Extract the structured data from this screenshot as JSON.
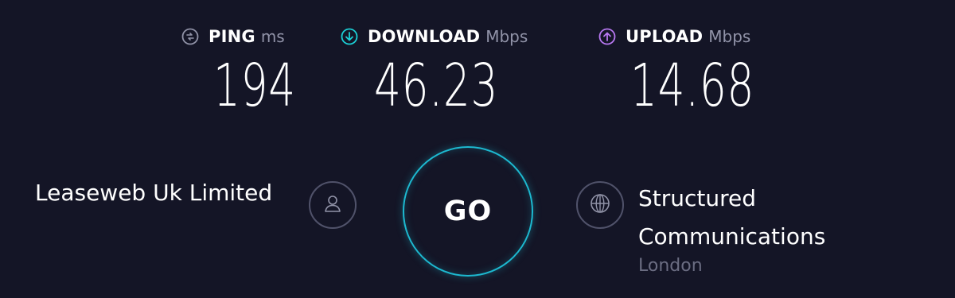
{
  "metrics": {
    "ping": {
      "label": "PING",
      "unit": "ms",
      "value": "194",
      "icon": "ping-icon",
      "color": "#9193a8"
    },
    "download": {
      "label": "DOWNLOAD",
      "unit": "Mbps",
      "value": "46.23",
      "icon": "download-arrow-icon",
      "color": "#1bd0d6"
    },
    "upload": {
      "label": "UPLOAD",
      "unit": "Mbps",
      "value": "14.68",
      "icon": "upload-arrow-icon",
      "color": "#b878f2"
    }
  },
  "provider": {
    "name": "Leaseweb Uk Limited",
    "icon": "user-icon"
  },
  "go_button": {
    "label": "GO",
    "accent": "#1db9d0"
  },
  "server": {
    "name": "Structured Communications",
    "location": "London",
    "icon": "globe-icon"
  }
}
